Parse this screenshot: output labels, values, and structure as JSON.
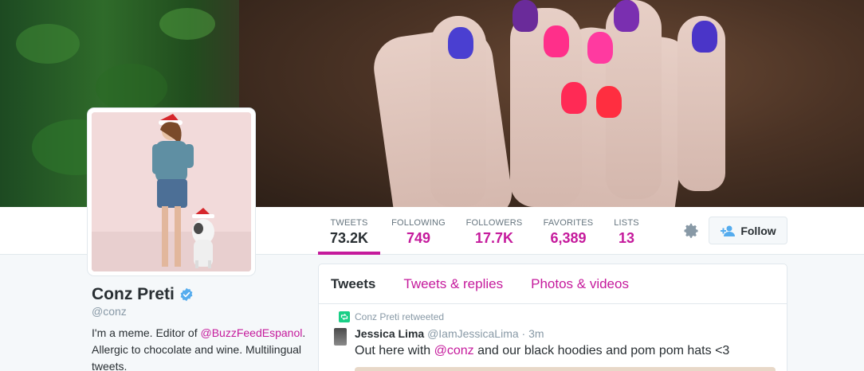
{
  "profile": {
    "name": "Conz Preti",
    "handle": "@conz",
    "bio_prefix": "I'm a meme.   Editor of ",
    "bio_mention": "@BuzzFeedEspanol",
    "bio_suffix": ". Allergic to chocolate and wine. Multilingual tweets."
  },
  "stats": [
    {
      "label": "TWEETS",
      "value": "73.2K"
    },
    {
      "label": "FOLLOWING",
      "value": "749"
    },
    {
      "label": "FOLLOWERS",
      "value": "17.7K"
    },
    {
      "label": "FAVORITES",
      "value": "6,389"
    },
    {
      "label": "LISTS",
      "value": "13"
    }
  ],
  "actions": {
    "follow_label": "Follow"
  },
  "timeline": {
    "tabs": [
      "Tweets",
      "Tweets & replies",
      "Photos & videos"
    ],
    "retweet_note": "Conz Preti retweeted",
    "tweet": {
      "author": "Jessica Lima",
      "author_handle": "@IamJessicaLima",
      "time": "· 3m",
      "text_prefix": "Out here with ",
      "text_mention": "@conz",
      "text_suffix": " and our black hoodies and pom pom hats <3"
    }
  },
  "colors": {
    "accent": "#c51a9c",
    "retweet_green": "#19cf86",
    "verified_blue": "#55acee"
  }
}
